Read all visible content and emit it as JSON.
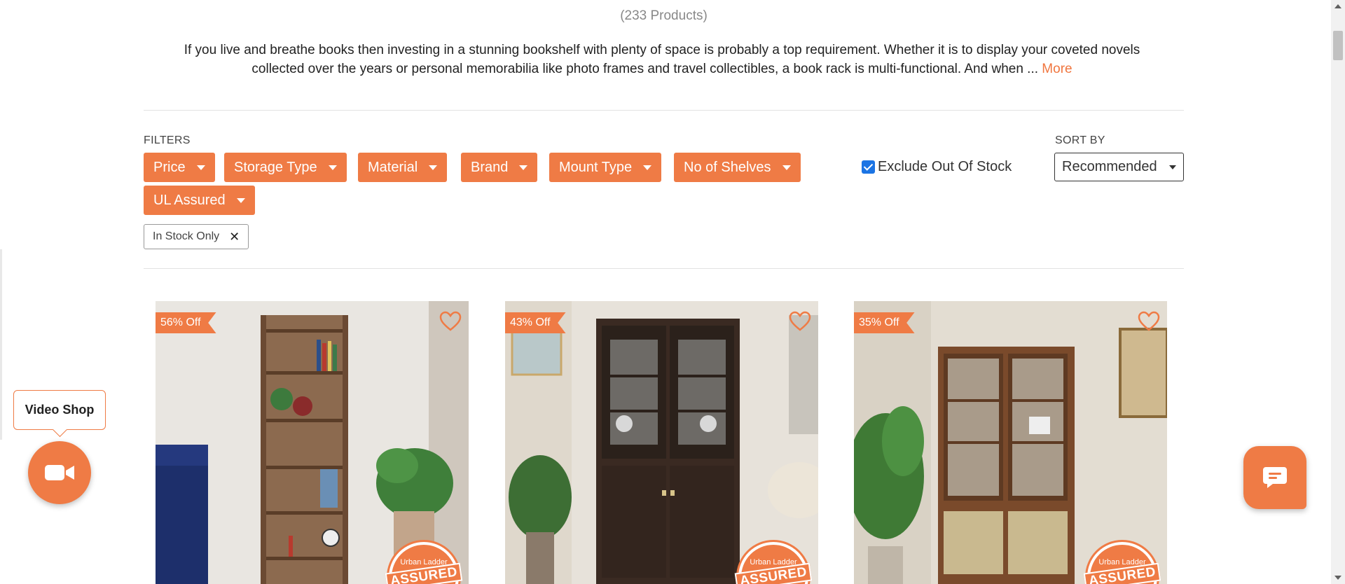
{
  "product_count": "(233 Products)",
  "description": {
    "line1": "If you live and breathe books then investing in a stunning bookshelf with plenty of space is probably a top requirement. Whether it is to display your coveted novels",
    "line2": "collected over the years or personal memorabilia like photo frames and travel collectibles, a book rack is multi-functional. And when ...",
    "more_label": "More"
  },
  "filters": {
    "label": "FILTERS",
    "buttons": [
      "Price",
      "Storage Type",
      "Material",
      "Brand",
      "Mount Type",
      "No of Shelves",
      "UL Assured"
    ],
    "exclude_out_of_stock": {
      "label": "Exclude Out Of Stock",
      "checked": true
    },
    "active_chip": "In Stock Only"
  },
  "sort": {
    "label": "SORT BY",
    "selected": "Recommended"
  },
  "products": [
    {
      "discount": "56% Off",
      "assured_badge": "ASSURED",
      "assured_brand": "Urban Ladder"
    },
    {
      "discount": "43% Off",
      "assured_badge": "ASSURED",
      "assured_brand": "Urban Ladder"
    },
    {
      "discount": "35% Off",
      "assured_badge": "ASSURED",
      "assured_brand": "Urban Ladder"
    }
  ],
  "video_shop": {
    "label": "Video Shop",
    "icon": "video-camera-icon"
  },
  "chat": {
    "icon": "chat-bubble-icon"
  },
  "colors": {
    "accent": "#ef7b45",
    "checkbox": "#1b74e4"
  }
}
